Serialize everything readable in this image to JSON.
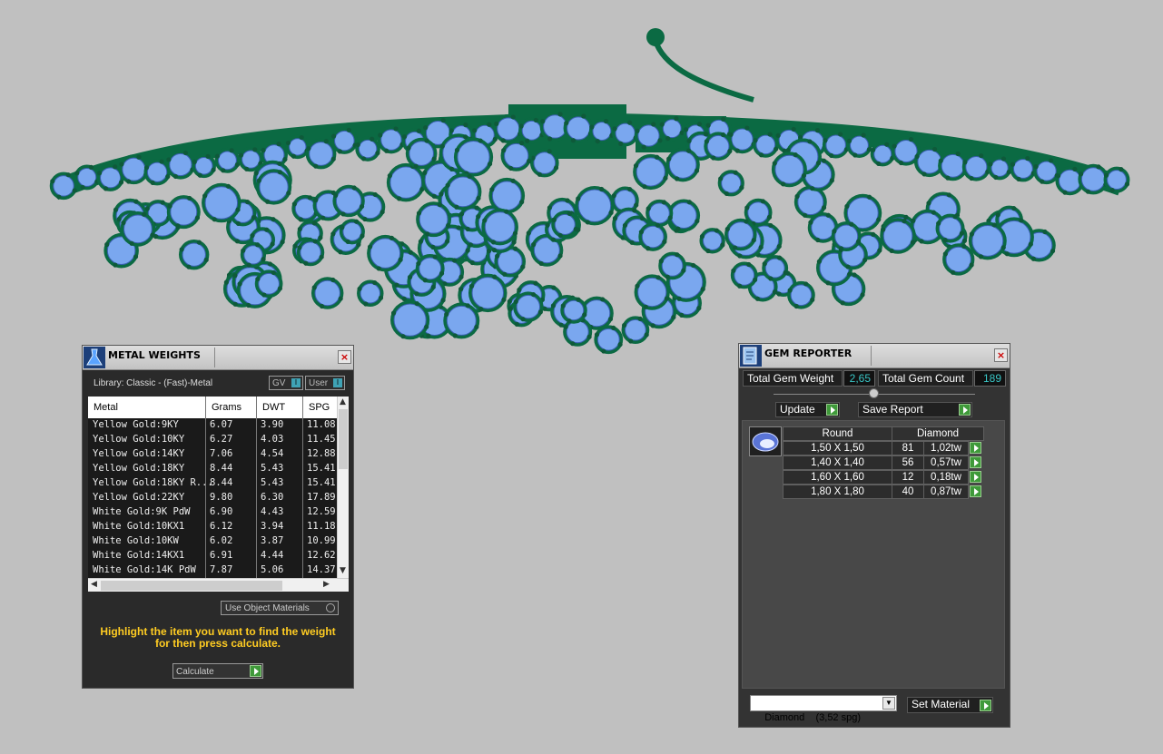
{
  "metal_weights": {
    "title": "METAL WEIGHTS",
    "library": "Library: Classic - (Fast)-Metal",
    "toggle_gv": "GV",
    "toggle_user": "User",
    "columns": [
      "Metal",
      "Grams",
      "DWT",
      "SPG"
    ],
    "rows": [
      [
        "Yellow Gold:9KY",
        "6.07",
        "3.90",
        "11.08"
      ],
      [
        "Yellow Gold:10KY",
        "6.27",
        "4.03",
        "11.45"
      ],
      [
        "Yellow Gold:14KY",
        "7.06",
        "4.54",
        "12.88"
      ],
      [
        "Yellow Gold:18KY",
        "8.44",
        "5.43",
        "15.41"
      ],
      [
        "Yellow Gold:18KY R...",
        "8.44",
        "5.43",
        "15.41"
      ],
      [
        "Yellow Gold:22KY",
        "9.80",
        "6.30",
        "17.89"
      ],
      [
        "White Gold:9K PdW",
        "6.90",
        "4.43",
        "12.59"
      ],
      [
        "White Gold:10KX1",
        "6.12",
        "3.94",
        "11.18"
      ],
      [
        "White Gold:10KW",
        "6.02",
        "3.87",
        "10.99"
      ],
      [
        "White Gold:14KX1",
        "6.91",
        "4.44",
        "12.62"
      ],
      [
        "White Gold:14K PdW",
        "7.87",
        "5.06",
        "14.37"
      ]
    ],
    "use_object_materials": "Use Object Materials",
    "hint": "Highlight the item you want to find the weight for then press calculate.",
    "calculate": "Calculate"
  },
  "gem_reporter": {
    "title": "GEM REPORTER",
    "total_weight_label": "Total Gem Weight",
    "total_weight_value": "2,65",
    "total_count_label": "Total Gem Count",
    "total_count_value": "189",
    "update": "Update",
    "save_report": "Save Report",
    "header_shape": "Round",
    "header_material": "Diamond",
    "rows": [
      [
        "1,50 X 1,50",
        "81",
        "1,02tw"
      ],
      [
        "1,40 X 1,40",
        "56",
        "0,57tw"
      ],
      [
        "1,60 X 1,60",
        "12",
        "0,18tw"
      ],
      [
        "1,80 X 1,80",
        "40",
        "0,87tw"
      ]
    ],
    "material_dropdown": "Diamond    (3,52 spg)",
    "set_material": "Set Material"
  },
  "colors": {
    "viewport_bg": "#c0c0c0",
    "metal": "#0b6a43",
    "gem": "#7aa7ef",
    "panel_bg": "#2a2a2a",
    "hint": "#ffcc22",
    "accent_value": "#39c6c6",
    "play_button": "#3f9a3a"
  }
}
